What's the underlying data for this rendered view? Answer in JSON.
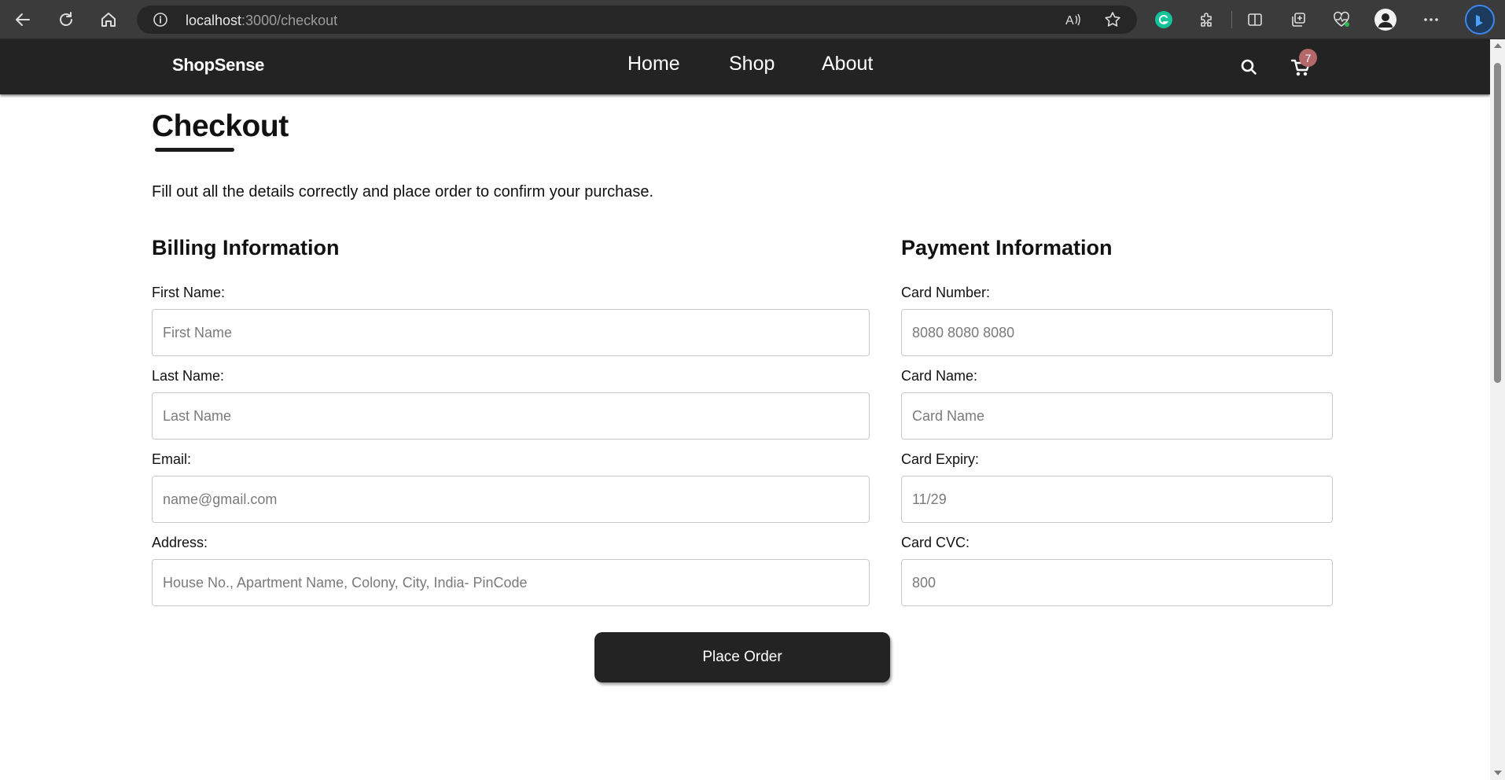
{
  "browser": {
    "url_host": "localhost",
    "url_path": ":3000/checkout",
    "icons": [
      "back-icon",
      "refresh-icon",
      "home-icon",
      "info-icon",
      "read-aloud-icon",
      "favorite-star-icon",
      "grammarly-icon",
      "extensions-icon",
      "split-screen-icon",
      "collections-icon",
      "browser-essentials-icon",
      "profile-avatar-icon",
      "more-menu-icon",
      "bing-copilot-icon"
    ]
  },
  "header": {
    "brand": "ShopSense",
    "nav": [
      "Home",
      "Shop",
      "About"
    ],
    "cart_count": "7",
    "background": "#232323"
  },
  "page": {
    "title": "Checkout",
    "subtitle": "Fill out all the details correctly and place order to confirm your purchase."
  },
  "billing": {
    "title": "Billing Information",
    "fields": [
      {
        "label": "First Name:",
        "placeholder": "First Name"
      },
      {
        "label": "Last Name:",
        "placeholder": "Last Name"
      },
      {
        "label": "Email:",
        "placeholder": "name@gmail.com"
      },
      {
        "label": "Address:",
        "placeholder": "House No., Apartment Name, Colony, City, India- PinCode"
      }
    ]
  },
  "payment": {
    "title": "Payment Information",
    "fields": [
      {
        "label": "Card Number:",
        "placeholder": "8080 8080 8080"
      },
      {
        "label": "Card Name:",
        "placeholder": "Card Name"
      },
      {
        "label": "Card Expiry:",
        "placeholder": "11/29"
      },
      {
        "label": "Card CVC:",
        "placeholder": "800"
      }
    ]
  },
  "actions": {
    "place_order": "Place Order"
  },
  "colors": {
    "browser_chrome": "#3b3b3b",
    "badge": "#b4686a",
    "button": "#232323"
  }
}
